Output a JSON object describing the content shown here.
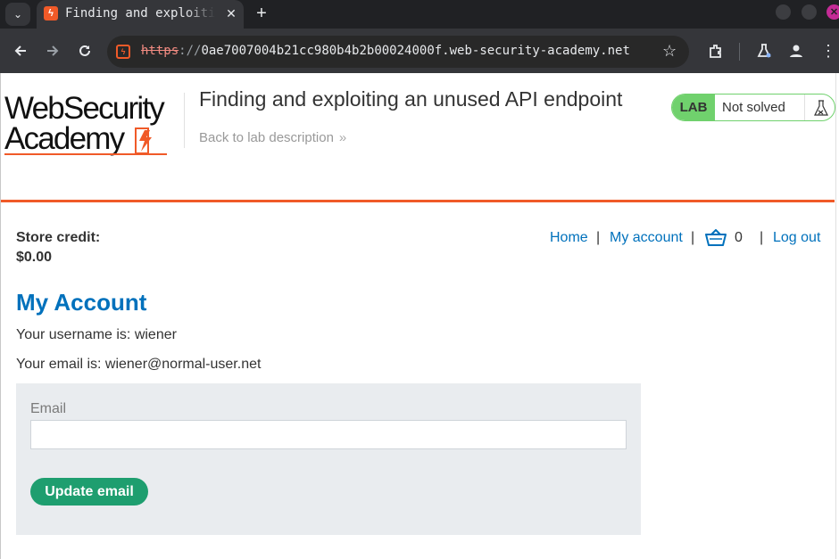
{
  "browser": {
    "tab_title": "Finding and exploiting an unused API endpoint",
    "tab_close": "✕",
    "new_tab": "+",
    "url_scheme": "https",
    "url_sep": "://",
    "url_host": "0ae7007004b21cc980b4b2b00024000f.web-security-academy.net",
    "icons": [
      "tab-search-icon",
      "back-arrow-icon",
      "forward-arrow-icon",
      "reload-icon",
      "site-info-icon",
      "bookmark-star-icon",
      "extensions-icon",
      "labs-flask-icon",
      "profile-icon",
      "kebab-menu-icon"
    ],
    "accent_color": "#f05a28"
  },
  "header": {
    "logo_line1": "WebSecurity",
    "logo_line2": "Academy",
    "lab_title": "Finding and exploiting an unused API endpoint",
    "back_link": "Back to lab description",
    "back_chevron": "»",
    "lab_badge": "LAB",
    "lab_status": "Not solved",
    "badge_color": "#70d16d"
  },
  "store": {
    "credit_label": "Store credit:",
    "credit_value": "$0.00"
  },
  "nav": {
    "home": "Home",
    "sep": "|",
    "my_account": "My account",
    "cart_count": "0",
    "log_out": "Log out",
    "link_color": "#0071bc"
  },
  "account": {
    "heading": "My Account",
    "username_line": "Your username is: wiener",
    "email_line": "Your email is: wiener@normal-user.net"
  },
  "form": {
    "email_label": "Email",
    "email_value": "",
    "submit_label": "Update email",
    "button_color": "#1e9e6f"
  }
}
